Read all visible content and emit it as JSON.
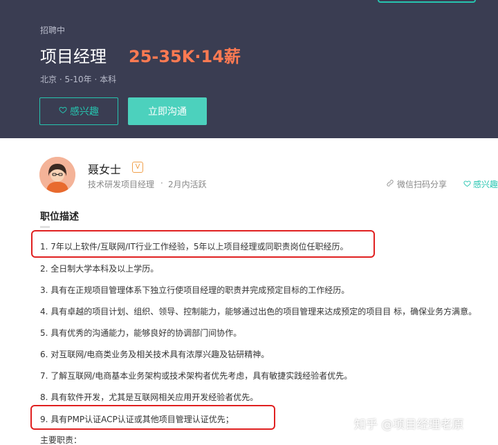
{
  "hero": {
    "status": "招聘中",
    "title": "项目经理",
    "salary": "25-35K·14薪",
    "meta": "北京 · 5-10年 · 本科",
    "interest_label": "感兴趣",
    "chat_label": "立即沟通"
  },
  "recruiter": {
    "name": "聂女士",
    "badge": "V",
    "title": "技术研发项目经理",
    "dot": "·",
    "active": "2月内活跃",
    "share_label": "微信扫码分享",
    "interest_label": "感兴趣"
  },
  "job_description": {
    "section_title": "职位描述",
    "requirements": [
      "1. 7年以上软件/互联网/IT行业工作经验，5年以上项目经理或同职责岗位任职经历。",
      "2. 全日制大学本科及以上学历。",
      "3. 具有在正规项目管理体系下独立行使项目经理的职责并完成预定目标的工作经历。",
      "4. 具有卓越的项目计划、组织、领导、控制能力，能够通过出色的项目管理来达成预定的项目目 标，确保业务方满意。",
      "5. 具有优秀的沟通能力，能够良好的协调部门间协作。",
      "6. 对互联网/电商类业务及相关技术具有浓厚兴趣及钻研精神。",
      "7. 了解互联网/电商基本业务架构或技术架构者优先考虑，具有敏捷实践经验者优先。",
      "8. 具有软件开发，尤其是互联网相关应用开发经验者优先。",
      "9. 具有PMP认证ACP认证或其他项目管理认证优先；"
    ],
    "duties_title": "主要职责："
  },
  "watermark": "知乎 @项目经理老原",
  "colors": {
    "hero_bg": "#3a3d52",
    "accent": "#26c5b0",
    "salary": "#ff7a52",
    "highlight_box": "#e02020"
  }
}
